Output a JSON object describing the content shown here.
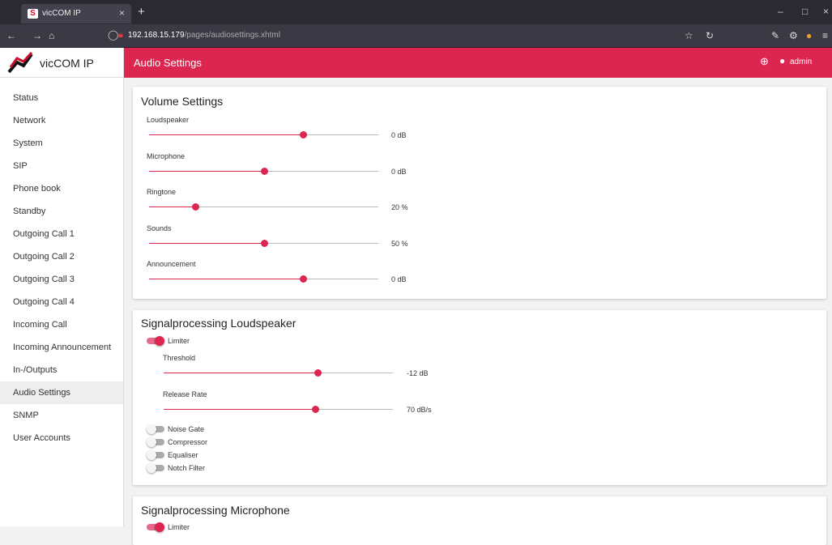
{
  "browser": {
    "tab_title": "vicCOM IP",
    "tab_close": "×",
    "new_tab": "+",
    "url_host": "192.168.15.179",
    "url_path": "/pages/audiosettings.xhtml",
    "minimize": "–",
    "maximize": "□",
    "close": "×"
  },
  "brand": {
    "name": "vicCOM IP"
  },
  "sidebar": {
    "items": [
      "Status",
      "Network",
      "System",
      "SIP",
      "Phone book",
      "Standby",
      "Outgoing Call 1",
      "Outgoing Call 2",
      "Outgoing Call 3",
      "Outgoing Call 4",
      "Incoming Call",
      "Incoming Announcement",
      "In-/Outputs",
      "Audio Settings",
      "SNMP",
      "User Accounts"
    ],
    "active": "Audio Settings"
  },
  "header": {
    "title": "Audio Settings",
    "user": "admin"
  },
  "volume": {
    "title": "Volume Settings",
    "sliders": [
      {
        "label": "Loudspeaker",
        "value": "0 dB",
        "level": 0.67
      },
      {
        "label": "Microphone",
        "value": "0 dB",
        "level": 0.5
      },
      {
        "label": "Ringtone",
        "value": "20 %",
        "level": 0.2
      },
      {
        "label": "Sounds",
        "value": "50 %",
        "level": 0.5
      },
      {
        "label": "Announcement",
        "value": "0 dB",
        "level": 0.67
      }
    ]
  },
  "sp_loud": {
    "title": "Signalprocessing Loudspeaker",
    "limiter": {
      "label": "Limiter",
      "on": true
    },
    "sliders": [
      {
        "label": "Threshold",
        "value": "-12 dB",
        "level": 0.67
      },
      {
        "label": "Release Rate",
        "value": "70 dB/s",
        "level": 0.66
      }
    ],
    "toggles": [
      {
        "label": "Noise Gate",
        "on": false
      },
      {
        "label": "Compressor",
        "on": false
      },
      {
        "label": "Equaliser",
        "on": false
      },
      {
        "label": "Notch Filter",
        "on": false
      }
    ]
  },
  "sp_mic": {
    "title": "Signalprocessing Microphone",
    "limiter": {
      "label": "Limiter",
      "on": true
    }
  },
  "colors": {
    "accent": "#dc2650"
  }
}
